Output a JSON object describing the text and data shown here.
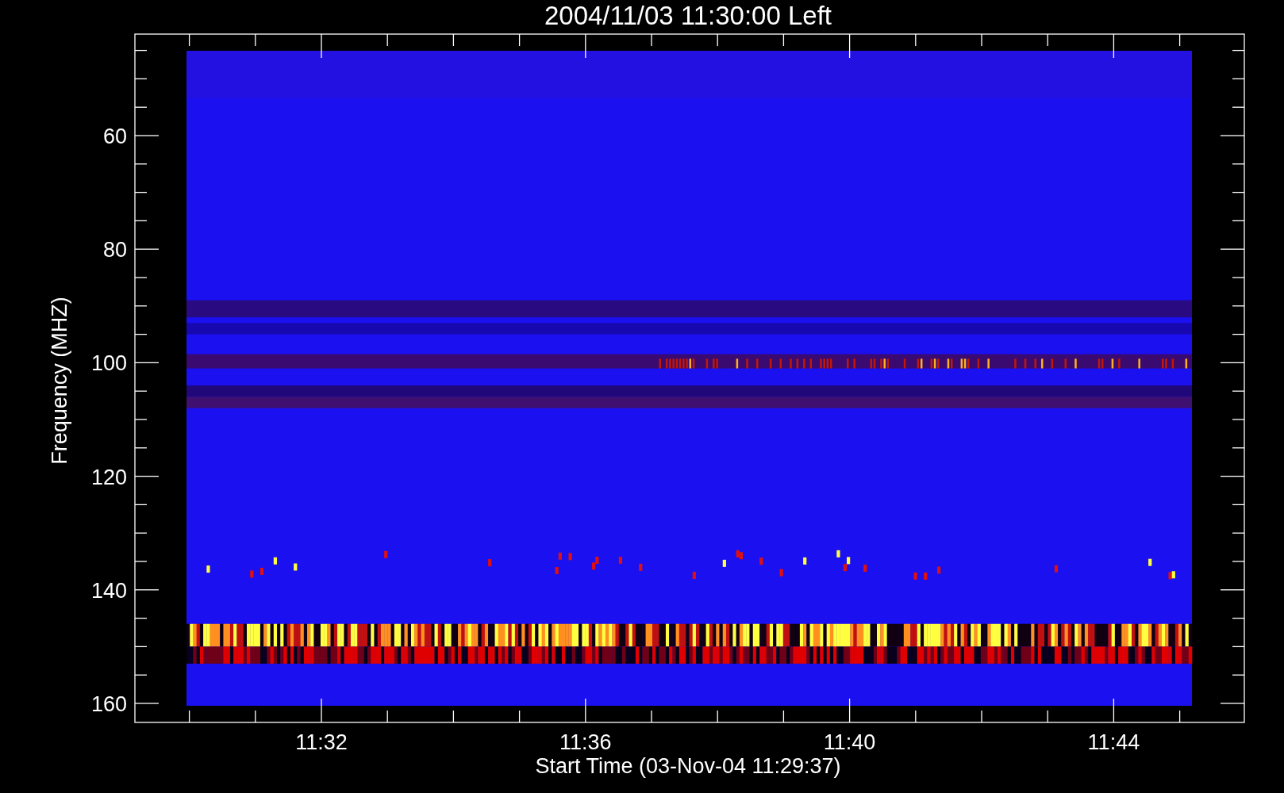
{
  "title": "2004/11/03 11:30:00 Left",
  "xlabel": "Start Time (03-Nov-04 11:29:37)",
  "ylabel": "Frequency (MHZ)",
  "yticks": [
    "60",
    "80",
    "100",
    "120",
    "140",
    "160"
  ],
  "xticks": [
    "11:32",
    "11:36",
    "11:40",
    "11:44"
  ]
}
